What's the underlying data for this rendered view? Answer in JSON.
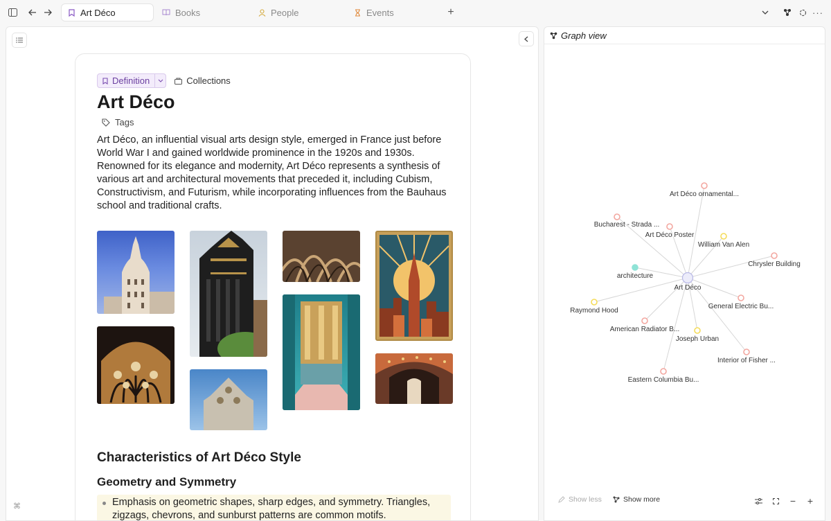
{
  "tabs": [
    {
      "label": "Art Déco",
      "icon": "bookmark-icon",
      "active": true
    },
    {
      "label": "Books",
      "icon": "book-icon",
      "active": false
    },
    {
      "label": "People",
      "icon": "person-icon",
      "active": false
    },
    {
      "label": "Events",
      "icon": "hourglass-icon",
      "active": false
    }
  ],
  "document": {
    "type_label": "Definition",
    "collections_label": "Collections",
    "title": "Art Déco",
    "tags_label": "Tags",
    "body": "Art Déco, an influential visual arts design style, emerged in France just before World War I and gained worldwide prominence in the 1920s and 1930s. Renowned for its elegance and modernity, Art Déco represents a synthesis of various art and architectural movements that preceded it, including Cubism, Constructivism, and Futurism, while incorporating influences from the Bauhaus school and traditional crafts.",
    "heading_2": "Characteristics of Art Déco Style",
    "heading_3": "Geometry and Symmetry",
    "bullet_1": "Emphasis on geometric shapes, sharp edges, and symmetry. Triangles, zigzags, chevrons, and sunburst patterns are common motifs."
  },
  "graph": {
    "title": "Graph view",
    "center": "Art Déco",
    "nodes": [
      {
        "label": "Art Déco ornamental...",
        "color": "#f3a7a0"
      },
      {
        "label": "Bucharest - Strada ...",
        "color": "#f3a7a0"
      },
      {
        "label": "Art Déco Poster",
        "color": "#f3a7a0"
      },
      {
        "label": "William Van Alen",
        "color": "#f5dc5a"
      },
      {
        "label": "Chrysler Building",
        "color": "#f3a7a0"
      },
      {
        "label": "architecture",
        "color": "#8fe3d6"
      },
      {
        "label": "General Electric Bu...",
        "color": "#f3a7a0"
      },
      {
        "label": "Raymond Hood",
        "color": "#f5dc5a"
      },
      {
        "label": "American Radiator B...",
        "color": "#f3a7a0"
      },
      {
        "label": "Joseph Urban",
        "color": "#f5dc5a"
      },
      {
        "label": "Interior of Fisher ...",
        "color": "#f3a7a0"
      },
      {
        "label": "Eastern Columbia Bu...",
        "color": "#f3a7a0"
      }
    ],
    "show_less": "Show less",
    "show_more": "Show more"
  }
}
